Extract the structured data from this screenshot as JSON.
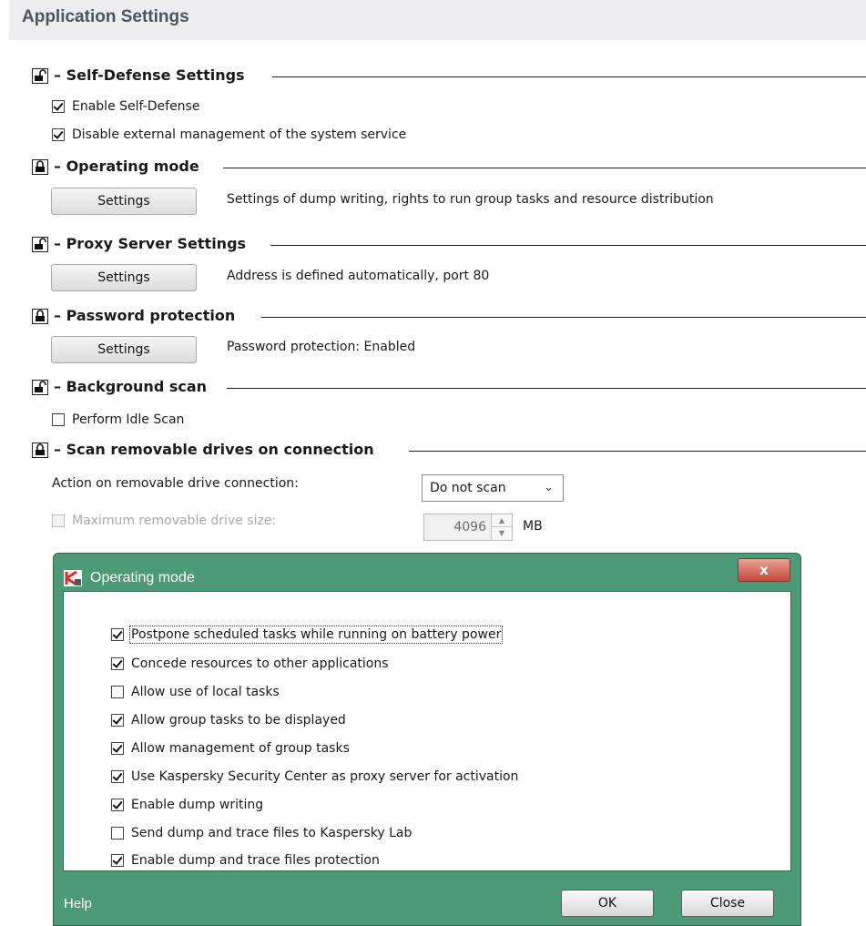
{
  "header": {
    "title": "Application Settings"
  },
  "sections": {
    "self_defense": {
      "title": "Self-Defense Settings",
      "lock": "unlocked",
      "options": [
        {
          "label": "Enable Self-Defense",
          "checked": true
        },
        {
          "label": "Disable external management of the system service",
          "checked": true
        }
      ]
    },
    "operating_mode": {
      "title": "Operating mode",
      "lock": "locked",
      "button": "Settings",
      "description": "Settings of dump writing, rights to run group tasks and resource distribution"
    },
    "proxy": {
      "title": "Proxy Server Settings",
      "lock": "unlocked",
      "button": "Settings",
      "description": "Address is defined automatically, port 80"
    },
    "password": {
      "title": "Password protection",
      "lock": "locked",
      "button": "Settings",
      "description": "Password protection: Enabled"
    },
    "background_scan": {
      "title": "Background scan",
      "lock": "unlocked",
      "options": [
        {
          "label": "Perform Idle Scan",
          "checked": false
        }
      ]
    },
    "removable": {
      "title": "Scan removable drives on connection",
      "lock": "locked",
      "action_label": "Action on removable drive connection:",
      "action_value": "Do not scan",
      "max_size_label": "Maximum removable drive size:",
      "max_size_checked": false,
      "max_size_value": "4096",
      "max_size_unit": "MB"
    }
  },
  "dialog": {
    "title": "Operating mode",
    "options": [
      {
        "label": "Postpone scheduled tasks while running on battery power",
        "checked": true
      },
      {
        "label": "Concede resources to other applications",
        "checked": true
      },
      {
        "label": "Allow use of local tasks",
        "checked": false
      },
      {
        "label": "Allow group tasks to be displayed",
        "checked": true
      },
      {
        "label": "Allow management of group tasks",
        "checked": true
      },
      {
        "label": "Use Kaspersky Security Center as proxy server for activation",
        "checked": true
      },
      {
        "label": "Enable dump writing",
        "checked": true
      },
      {
        "label": "Send dump and trace files to Kaspersky Lab",
        "checked": false
      },
      {
        "label": "Enable dump and trace files protection",
        "checked": true
      }
    ],
    "help": "Help",
    "ok": "OK",
    "close": "Close",
    "close_glyph": "x"
  },
  "colors": {
    "dialog_frame": "#4d9a76",
    "close_button": "#c5493a",
    "header_bg": "#ecedef"
  },
  "icons": {
    "lock_unlocked": "unlocked-padlock-icon",
    "lock_locked": "locked-padlock-icon",
    "app": "kaspersky-k-icon"
  }
}
